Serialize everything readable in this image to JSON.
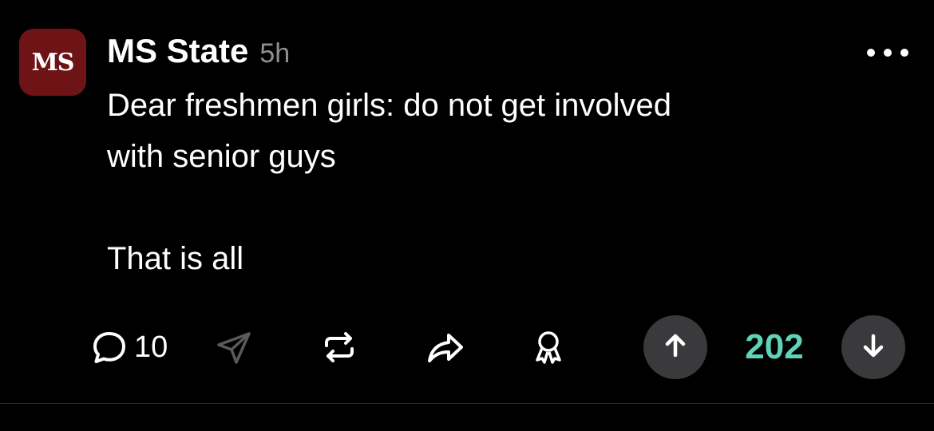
{
  "post": {
    "channel": {
      "avatar_text": "MS",
      "avatar_color": "#6e1416",
      "name": "MS State"
    },
    "timestamp": "5h",
    "body": "Dear freshmen girls: do not get involved\nwith senior guys\n\nThat is all",
    "more_icon": "ellipsis-icon"
  },
  "actions": {
    "comments_icon": "comment-bubble-icon",
    "comments_count": "10",
    "send_icon": "paper-plane-icon",
    "repost_icon": "repost-icon",
    "share_icon": "share-arrow-icon",
    "award_icon": "award-ribbon-icon",
    "upvote_icon": "arrow-up-icon",
    "downvote_icon": "arrow-down-icon",
    "vote_count": "202",
    "vote_count_color": "#5fd3b8"
  }
}
